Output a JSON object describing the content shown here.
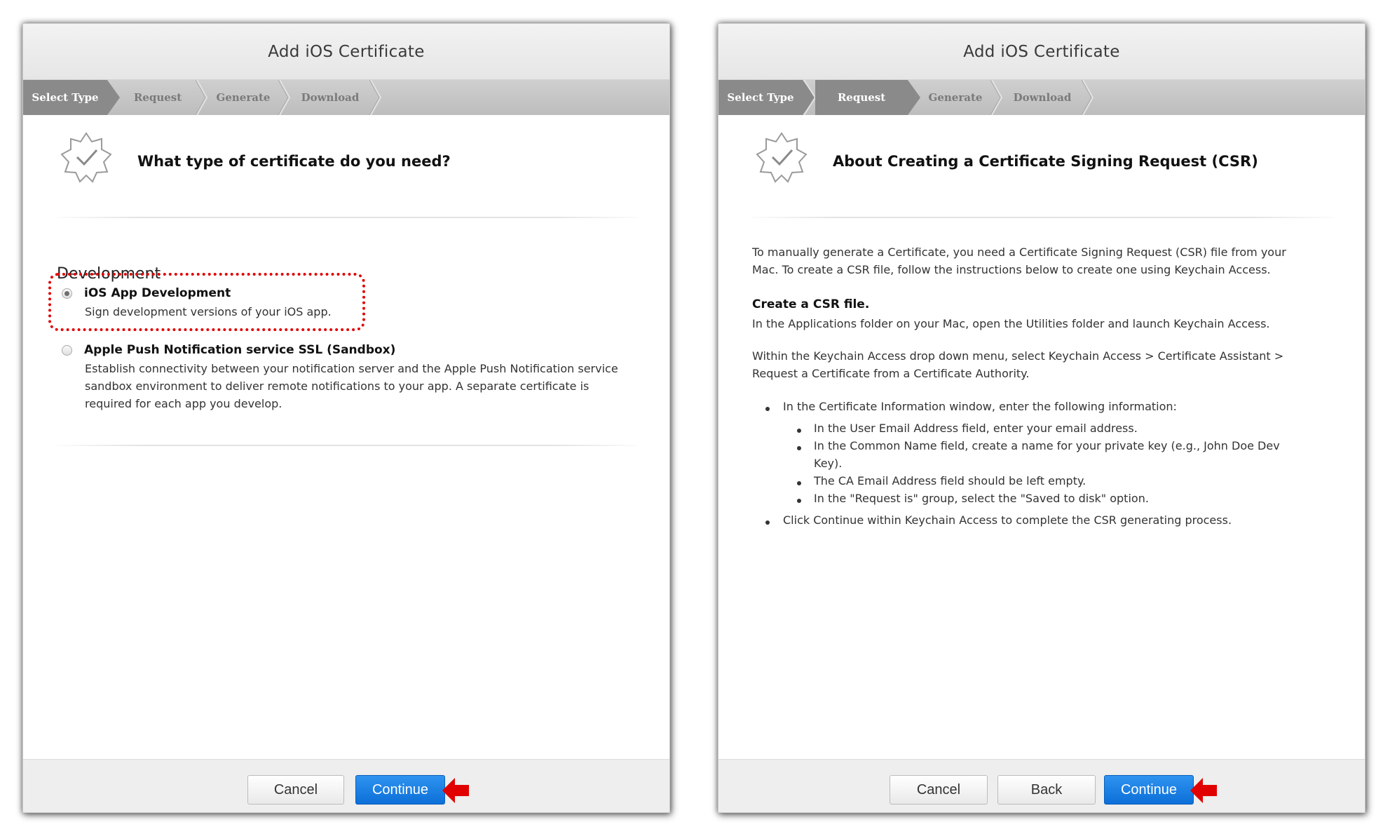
{
  "left": {
    "title": "Add iOS Certificate",
    "steps": [
      "Select Type",
      "Request",
      "Generate",
      "Download"
    ],
    "active_step": "Select Type",
    "heading": "What type of certificate do you need?",
    "section": "Development",
    "options": [
      {
        "title": "iOS App Development",
        "desc": [
          "Sign development versions of your iOS app."
        ],
        "selected": true
      },
      {
        "title": "Apple Push Notification service SSL (Sandbox)",
        "desc": [
          "Establish connectivity between your notification server and the Apple Push Notification service",
          "sandbox environment to deliver remote notifications to your app. A separate certificate is",
          "required for each app you develop."
        ],
        "selected": false
      }
    ],
    "buttons": {
      "cancel": "Cancel",
      "continue": "Continue"
    }
  },
  "right": {
    "title": "Add iOS Certificate",
    "steps": [
      "Select Type",
      "Request",
      "Generate",
      "Download"
    ],
    "active_step": "Request",
    "heading": "About Creating a Certificate Signing Request (CSR)",
    "intro": [
      "To manually generate a Certificate, you need a Certificate Signing Request (CSR) file from your",
      "Mac. To create a CSR file, follow the instructions below to create one using Keychain Access."
    ],
    "create_title": "Create a CSR file.",
    "create_text": "In the Applications folder on your Mac, open the Utilities folder and launch Keychain Access.",
    "menu_text": [
      "Within the Keychain Access drop down menu, select Keychain Access > Certificate Assistant >",
      "Request a Certificate from a Certificate Authority."
    ],
    "bullet1": "In the Certificate Information window, enter the following information:",
    "sub_bullets": [
      "In the User Email Address field, enter your email address.",
      "In the Common Name field, create a name for your private key (e.g., John Doe Dev",
      "Key).",
      "The CA Email Address field should be left empty.",
      "In the \"Request is\" group, select the \"Saved to disk\" option."
    ],
    "bullet2": "Click Continue within Keychain Access to complete the CSR generating process.",
    "buttons": {
      "cancel": "Cancel",
      "back": "Back",
      "continue": "Continue"
    }
  },
  "colors": {
    "accent_blue": "#1a7fe6",
    "annotation_red": "#e10000"
  }
}
